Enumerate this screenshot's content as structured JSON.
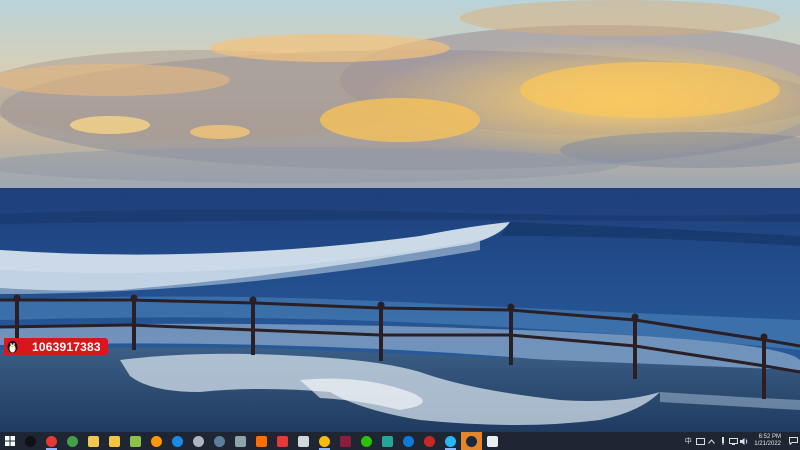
{
  "overlay": {
    "number": "1063917383"
  },
  "taskbar": {
    "start_icon": "windows-start-icon",
    "pinned": [
      {
        "name": "penguin-app-icon",
        "color": "#111111",
        "shape": "round",
        "state": "none"
      },
      {
        "name": "red-circle-app-icon",
        "color": "#e53935",
        "shape": "round",
        "state": "running"
      },
      {
        "name": "chrome-icon",
        "color": "#43a047",
        "shape": "round",
        "state": "none"
      },
      {
        "name": "yellow-app-icon",
        "color": "#f2c94c",
        "shape": "square",
        "state": "none"
      },
      {
        "name": "folder-icon",
        "color": "#f4c542",
        "shape": "square",
        "state": "none"
      },
      {
        "name": "notes-app-icon",
        "color": "#8bc34a",
        "shape": "square",
        "state": "none"
      },
      {
        "name": "g-app-icon",
        "color": "#ff9800",
        "shape": "round",
        "state": "none"
      },
      {
        "name": "browser-blue-icon",
        "color": "#1e88e5",
        "shape": "round",
        "state": "none"
      },
      {
        "name": "settings-icon",
        "color": "#b0b6bf",
        "shape": "round",
        "state": "none"
      },
      {
        "name": "steam-icon",
        "color": "#5c7e9e",
        "shape": "round",
        "state": "none"
      },
      {
        "name": "tools-app-icon",
        "color": "#90a4ae",
        "shape": "square",
        "state": "none"
      },
      {
        "name": "firewall-app-icon",
        "color": "#ff6f00",
        "shape": "square",
        "state": "none"
      },
      {
        "name": "calendar-app-icon",
        "color": "#e53935",
        "shape": "square",
        "state": "none"
      },
      {
        "name": "plane-app-icon",
        "color": "#cfd8dc",
        "shape": "square",
        "state": "none"
      },
      {
        "name": "chrome-running-icon",
        "color": "#fbbc05",
        "shape": "round",
        "state": "running"
      },
      {
        "name": "heart-app-icon",
        "color": "#8e1b3b",
        "shape": "square",
        "state": "none"
      },
      {
        "name": "wechat-icon",
        "color": "#2dc100",
        "shape": "round",
        "state": "none"
      },
      {
        "name": "photos-app-icon",
        "color": "#26a69a",
        "shape": "square",
        "state": "none"
      },
      {
        "name": "edge-icon",
        "color": "#0f7bd6",
        "shape": "round",
        "state": "none"
      },
      {
        "name": "red-app-icon",
        "color": "#c62828",
        "shape": "round",
        "state": "none"
      },
      {
        "name": "ie-icon",
        "color": "#29b6f6",
        "shape": "round",
        "state": "running"
      },
      {
        "name": "steam-active-icon",
        "color": "#1b2838",
        "shape": "round",
        "state": "active"
      },
      {
        "name": "airplane-app-icon",
        "color": "#eceff1",
        "shape": "square",
        "state": "none"
      }
    ],
    "tray": {
      "ime_label": "中",
      "tray_icons": [
        "keyboard-icon",
        "chevron-up-icon",
        "speaker-icon",
        "network-icon",
        "volume-icon"
      ],
      "time": "6:52 PM",
      "date": "1/21/2022",
      "notification_icon": "notification-icon"
    }
  }
}
